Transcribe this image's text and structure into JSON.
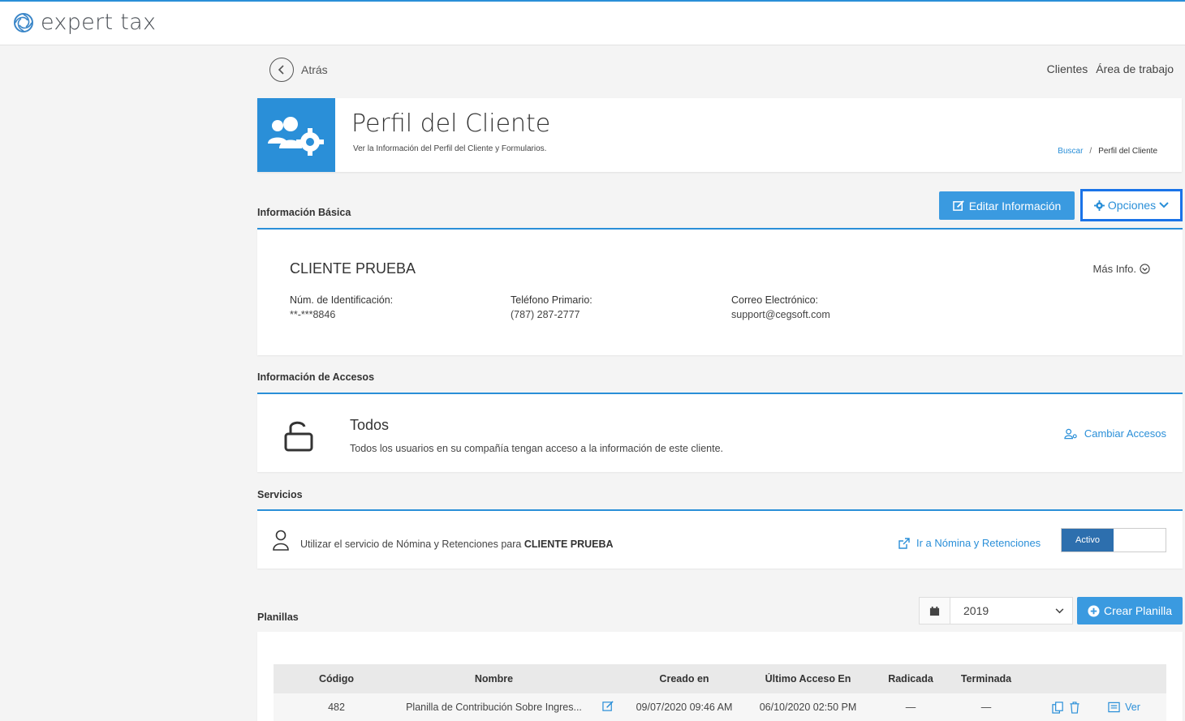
{
  "brand": {
    "name": "expert tax"
  },
  "nav": {
    "back": "Atrás",
    "links": [
      "Clientes",
      "Área de trabajo"
    ]
  },
  "header": {
    "title": "Perfil del Cliente",
    "subtitle": "Ver la Información del Perfil del Cliente y Formularios.",
    "breadcrumb": {
      "link": "Buscar",
      "separator": "/",
      "current": "Perfil del Cliente"
    }
  },
  "basic": {
    "section_title": "Información Básica",
    "edit_button": "Editar Información",
    "options_button": "Opciones",
    "client_name": "CLIENTE PRUEBA",
    "more_info": "Más Info.",
    "fields": [
      {
        "label": "Núm. de Identificación:",
        "value": "**-***8846"
      },
      {
        "label": "Teléfono Primario:",
        "value": "(787) 287-2777"
      },
      {
        "label": "Correo Electrónico:",
        "value": "support@cegsoft.com"
      }
    ]
  },
  "access": {
    "section_title": "Información de Accesos",
    "title": "Todos",
    "description": "Todos los usuarios en su compañía tengan acceso a la información de este cliente.",
    "change_link": "Cambiar Accesos"
  },
  "services": {
    "section_title": "Servicios",
    "text_prefix": "Utilizar el servicio de Nómina y Retenciones para",
    "text_client": "CLIENTE PRUEBA",
    "link": "Ir a Nómina y Retenciones",
    "toggle_label": "Activo"
  },
  "planillas": {
    "section_title": "Planillas",
    "year": "2019",
    "create_button": "Crear Planilla",
    "columns": [
      "Código",
      "Nombre",
      "Creado en",
      "Último Acceso En",
      "Radicada",
      "Terminada"
    ],
    "rows": [
      {
        "codigo": "482",
        "nombre": "Planilla de Contribución Sobre Ingres...",
        "creado": "09/07/2020 09:46 AM",
        "acceso": "06/10/2020 02:50 PM",
        "radicada": "—",
        "terminada": "—",
        "ver": "Ver"
      }
    ]
  },
  "colors": {
    "accent": "#2a8fd8",
    "toggle_active": "#2d6fae",
    "focus_outline": "#1a73e8"
  }
}
